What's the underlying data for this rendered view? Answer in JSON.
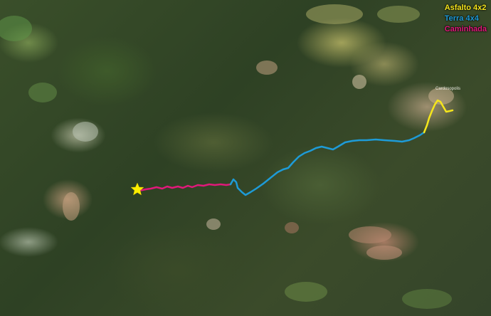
{
  "legend": [
    {
      "label": "Asfalto 4x2",
      "color": "#f5e61c"
    },
    {
      "label": "Terra 4x4",
      "color": "#1e9bd7"
    },
    {
      "label": "Caminhada",
      "color": "#e0197a"
    }
  ],
  "town_label": "Cardosopolis",
  "marker": {
    "icon": "star-icon",
    "color": "#ffee00"
  }
}
